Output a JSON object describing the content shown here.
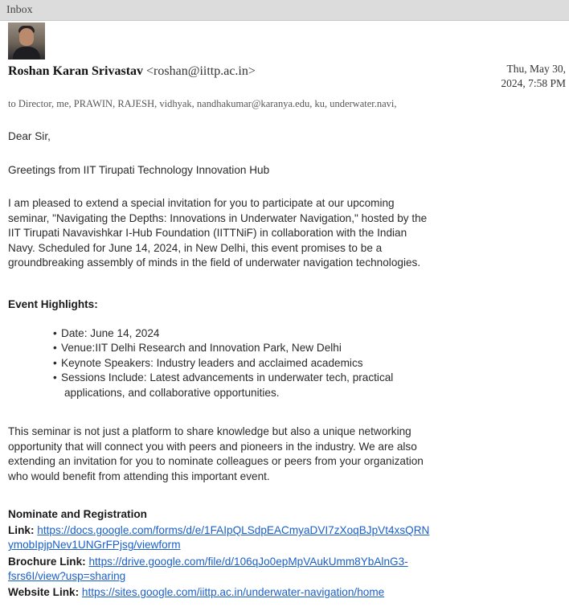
{
  "inbox": {
    "title": "Inbox"
  },
  "message": {
    "sender_name": "Roshan Karan Srivastav",
    "sender_email": "<roshan@iittp.ac.in>",
    "date_line1": "Thu, May 30,",
    "date_line2": "2024, 7:58 PM",
    "recipients": "to Director, me, PRAWIN, RAJESH, vidhyak, nandhakumar@karanya.edu, ku, underwater.navi,",
    "salutation": "Dear Sir,",
    "greeting": "Greetings from IIT Tirupati Technology Innovation Hub",
    "intro_lines": [
      "I am pleased to extend a special invitation for you to participate at our upcoming",
      "seminar, \"Navigating the Depths: Innovations in Underwater Navigation,\" hosted by the",
      "IIT Tirupati Navavishkar I-Hub Foundation (IITTNiF) in collaboration with the Indian",
      "Navy. Scheduled for June 14, 2024, in New Delhi, this event promises to be a",
      "groundbreaking assembly of minds in the field of underwater navigation technologies."
    ],
    "highlights_heading": "Event Highlights:",
    "highlights": [
      "Date: June 14, 2024",
      "Venue:IIT Delhi Research and Innovation Park, New Delhi",
      "Keynote Speakers: Industry leaders and acclaimed academics",
      "Sessions Include: Latest advancements in underwater tech, practical"
    ],
    "highlights_cont": "applications, and collaborative opportunities.",
    "closing_lines": [
      "This seminar is not just a platform to share knowledge but also a unique networking",
      "opportunity that will connect you with peers and pioneers in the industry. We are also",
      "extending an invitation for you to nominate colleagues or peers from your organization",
      "who would benefit from attending this important event."
    ],
    "nominate_heading": "Nominate and Registration",
    "link_label": "Link:",
    "link_url_line1": "https://docs.google.com/forms/d/e/1FAIpQLSdpEACmyaDVI7zXoqBJpVt4xsQRN",
    "link_url_line2": "ymobIpjpNev1UNGrFPjsg/viewform",
    "brochure_label": "Brochure Link:",
    "brochure_url_line1": "https://drive.google.com/file/d/106qJo0epMpVAukUmm8YbAlnG3-",
    "brochure_url_line2": "fsrs6I/view?usp=sharing",
    "website_label": "Website Link:",
    "website_url": "https://sites.google.com/iittp.ac.in/underwater-navigation/home"
  }
}
